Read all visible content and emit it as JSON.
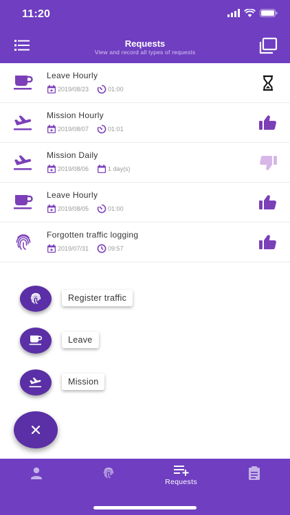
{
  "status_bar": {
    "time": "11:20"
  },
  "header": {
    "title": "Requests",
    "subtitle": "View and record all types of requests"
  },
  "requests": [
    {
      "type_icon": "coffee-cup-icon",
      "title": "Leave Hourly",
      "date": "2019/08/23",
      "duration_icon": "timer-icon",
      "duration": "01:00",
      "status": "pending",
      "status_icon": "hourglass-icon"
    },
    {
      "type_icon": "airplane-icon",
      "title": "Mission Hourly",
      "date": "2019/08/07",
      "duration_icon": "timer-icon",
      "duration": "01:01",
      "status": "approved",
      "status_icon": "thumbs-up-icon"
    },
    {
      "type_icon": "airplane-icon",
      "title": "Mission Daily",
      "date": "2019/08/06",
      "duration_icon": "calendar-days-icon",
      "duration": "1 day(s)",
      "status": "rejected",
      "status_icon": "thumbs-down-icon"
    },
    {
      "type_icon": "coffee-cup-icon",
      "title": "Leave Hourly",
      "date": "2019/08/05",
      "duration_icon": "timer-icon",
      "duration": "01:00",
      "status": "approved",
      "status_icon": "thumbs-up-icon"
    },
    {
      "type_icon": "fingerprint-icon",
      "title": "Forgotten traffic logging",
      "date": "2019/07/31",
      "duration_icon": "clock-icon",
      "duration": "09:57",
      "status": "approved",
      "status_icon": "thumbs-up-icon"
    }
  ],
  "fab_menu": {
    "register_traffic": "Register traffic",
    "leave": "Leave",
    "mission": "Mission"
  },
  "bottom_nav": {
    "requests_label": "Requests"
  },
  "colors": {
    "primary": "#6f3ec1",
    "fab": "#5b2fa6",
    "icon_accent": "#7b3fb8",
    "rejected": "#d7b6e8",
    "meta_text": "#9a9a9a"
  }
}
